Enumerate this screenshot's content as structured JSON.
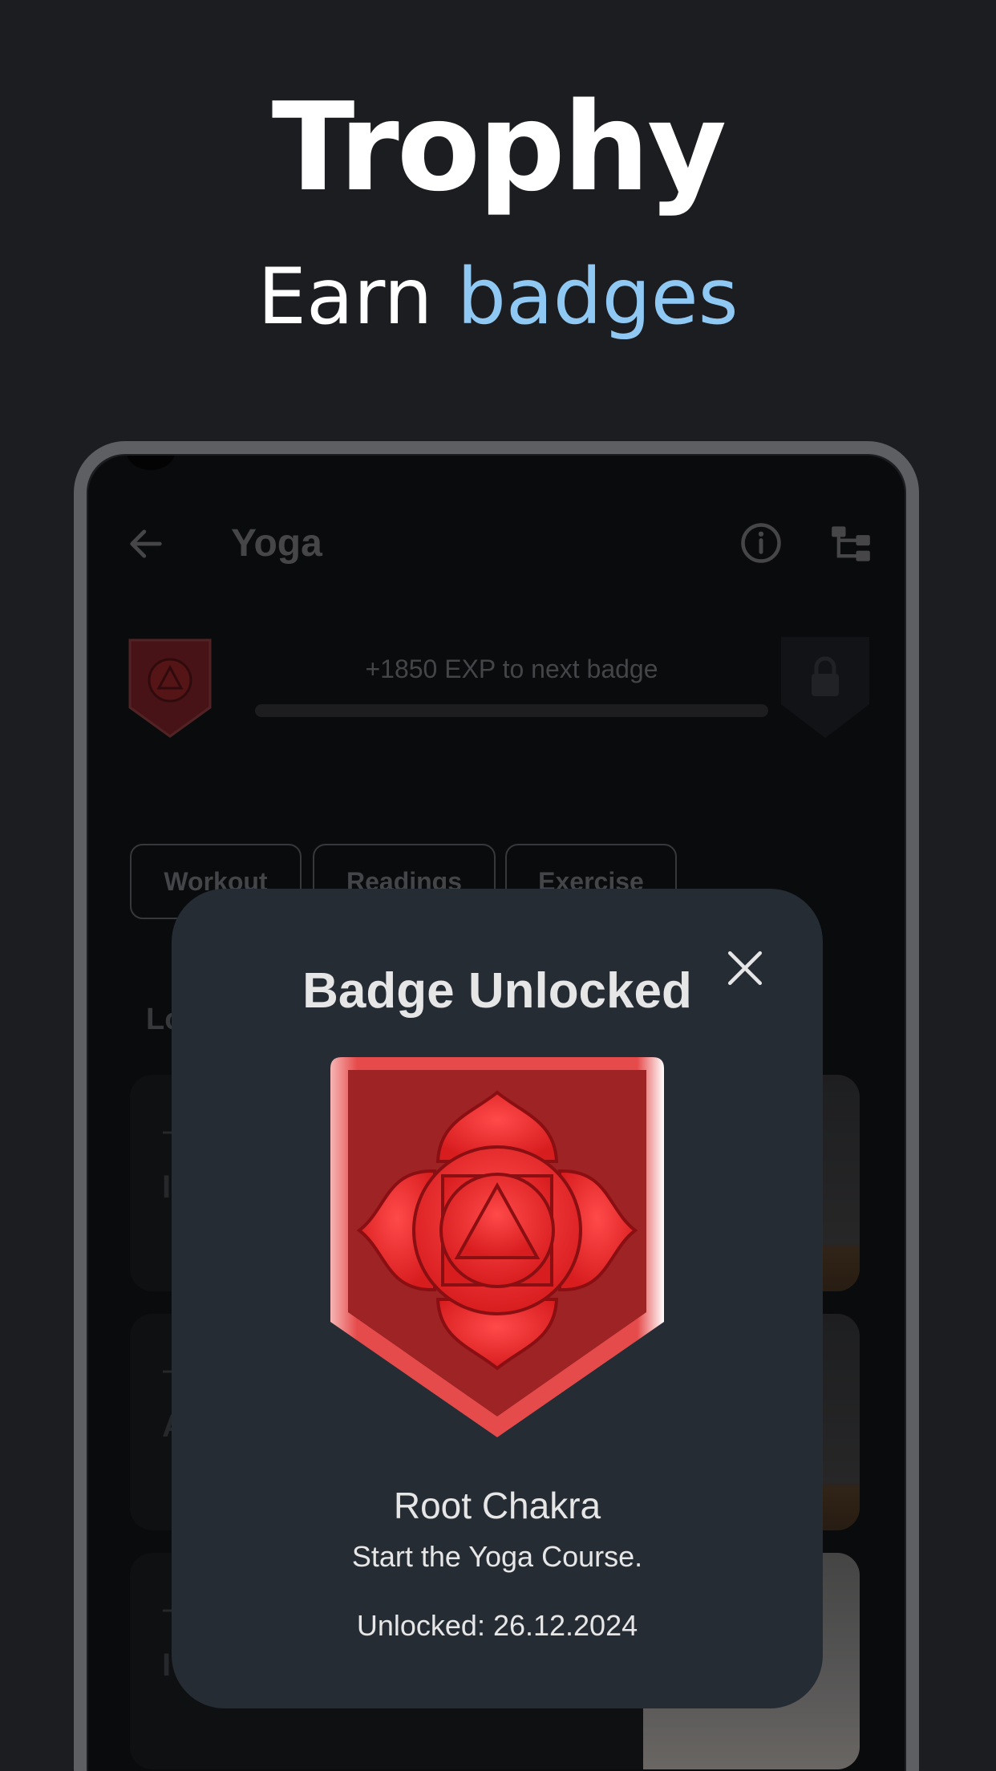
{
  "promo": {
    "title": "Trophy",
    "subtitle_plain": "Earn ",
    "subtitle_accent": "badges"
  },
  "appbar": {
    "title": "Yoga",
    "back_icon": "arrow-back-icon",
    "info_icon": "info-icon",
    "tree_icon": "tree-structure-icon"
  },
  "progress": {
    "exp_text": "+1850 EXP to next badge",
    "fraction": 0.0
  },
  "chips": [
    {
      "label": "Workout"
    },
    {
      "label": "Readings"
    },
    {
      "label": "Exercise"
    }
  ],
  "section_label": "Lo",
  "cards": [
    {
      "line1": "–",
      "line2": "I"
    },
    {
      "line1": "–",
      "line2": "A"
    },
    {
      "line1": "–",
      "line2": "I"
    }
  ],
  "dialog": {
    "title": "Badge Unlocked",
    "badge_name": "Root Chakra",
    "badge_description": "Start the Yoga Course.",
    "unlocked_text": "Unlocked: 26.12.2024",
    "close_icon": "close-icon"
  },
  "colors": {
    "accent": "#90c8f4",
    "background": "#1c1d20",
    "dialog": "#262c34",
    "badge_red": "#e8292a"
  }
}
